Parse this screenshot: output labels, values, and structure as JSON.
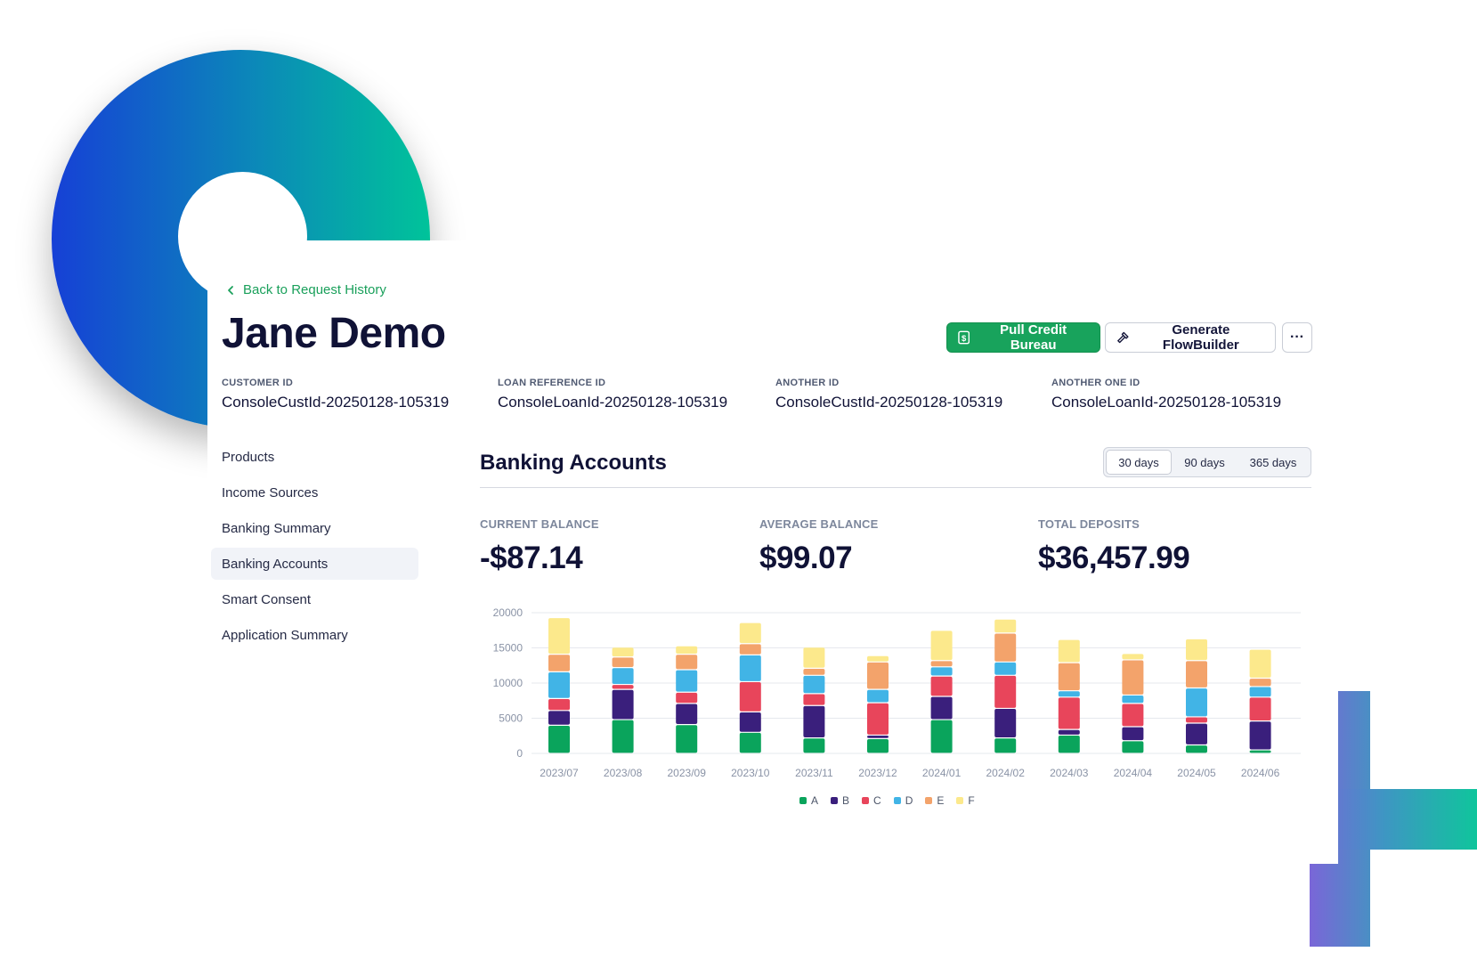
{
  "back_link": {
    "label": "Back to Request History"
  },
  "page_title": "Jane Demo",
  "actions": {
    "pull_credit": "Pull Credit Bureau",
    "generate_flowbuilder": "Generate FlowBuilder",
    "more": "···"
  },
  "ids": [
    {
      "label": "CUSTOMER ID",
      "value": "ConsoleCustId-20250128-105319"
    },
    {
      "label": "LOAN REFERENCE ID",
      "value": "ConsoleLoanId-20250128-105319"
    },
    {
      "label": "ANOTHER ID",
      "value": "ConsoleCustId-20250128-105319"
    },
    {
      "label": "ANOTHER ONE ID",
      "value": "ConsoleLoanId-20250128-105319"
    }
  ],
  "nav": [
    {
      "label": "Products",
      "active": false
    },
    {
      "label": "Income Sources",
      "active": false
    },
    {
      "label": "Banking Summary",
      "active": false
    },
    {
      "label": "Banking Accounts",
      "active": true
    },
    {
      "label": "Smart Consent",
      "active": false
    },
    {
      "label": "Application Summary",
      "active": false
    }
  ],
  "section": {
    "title": "Banking Accounts",
    "periods": [
      {
        "label": "30 days",
        "active": true
      },
      {
        "label": "90 days",
        "active": false
      },
      {
        "label": "365 days",
        "active": false
      }
    ]
  },
  "stats": [
    {
      "label": "CURRENT BALANCE",
      "value": "-$87.14"
    },
    {
      "label": "AVERAGE BALANCE",
      "value": "$99.07"
    },
    {
      "label": "TOTAL DEPOSITS",
      "value": "$36,457.99"
    }
  ],
  "colors": {
    "accent_green": "#18a35c",
    "series": [
      "#0aa45c",
      "#3a1f7c",
      "#e8455b",
      "#41b4e6",
      "#f3a36b",
      "#fce98c"
    ]
  },
  "chart_data": {
    "type": "bar",
    "stacked": true,
    "categories": [
      "2023/07",
      "2023/08",
      "2023/09",
      "2023/10",
      "2023/11",
      "2023/12",
      "2024/01",
      "2024/02",
      "2024/03",
      "2024/04",
      "2024/05",
      "2024/06"
    ],
    "series": [
      {
        "name": "A",
        "values": [
          4000,
          4800,
          4100,
          3000,
          2200,
          2100,
          4800,
          2200,
          2600,
          1800,
          1200,
          500
        ]
      },
      {
        "name": "B",
        "values": [
          2100,
          4300,
          3000,
          2900,
          4600,
          500,
          3300,
          4200,
          800,
          2000,
          3100,
          4100
        ]
      },
      {
        "name": "C",
        "values": [
          1700,
          700,
          1600,
          4300,
          1700,
          4600,
          2900,
          4700,
          4600,
          3300,
          900,
          3400
        ]
      },
      {
        "name": "D",
        "values": [
          3800,
          2400,
          3200,
          3800,
          2600,
          1900,
          1300,
          1900,
          900,
          1200,
          4100,
          1500
        ]
      },
      {
        "name": "E",
        "values": [
          2500,
          1500,
          2200,
          1600,
          1000,
          3900,
          900,
          4100,
          4000,
          5000,
          3900,
          1200
        ]
      },
      {
        "name": "F",
        "values": [
          5200,
          1400,
          1200,
          3000,
          3000,
          900,
          4300,
          2000,
          3300,
          900,
          3100,
          4100
        ]
      }
    ],
    "y_ticks": [
      "0",
      "5000",
      "10000",
      "15000",
      "20000"
    ],
    "ylim": [
      0,
      20000
    ],
    "grid": true,
    "legend": "bottom-center"
  }
}
